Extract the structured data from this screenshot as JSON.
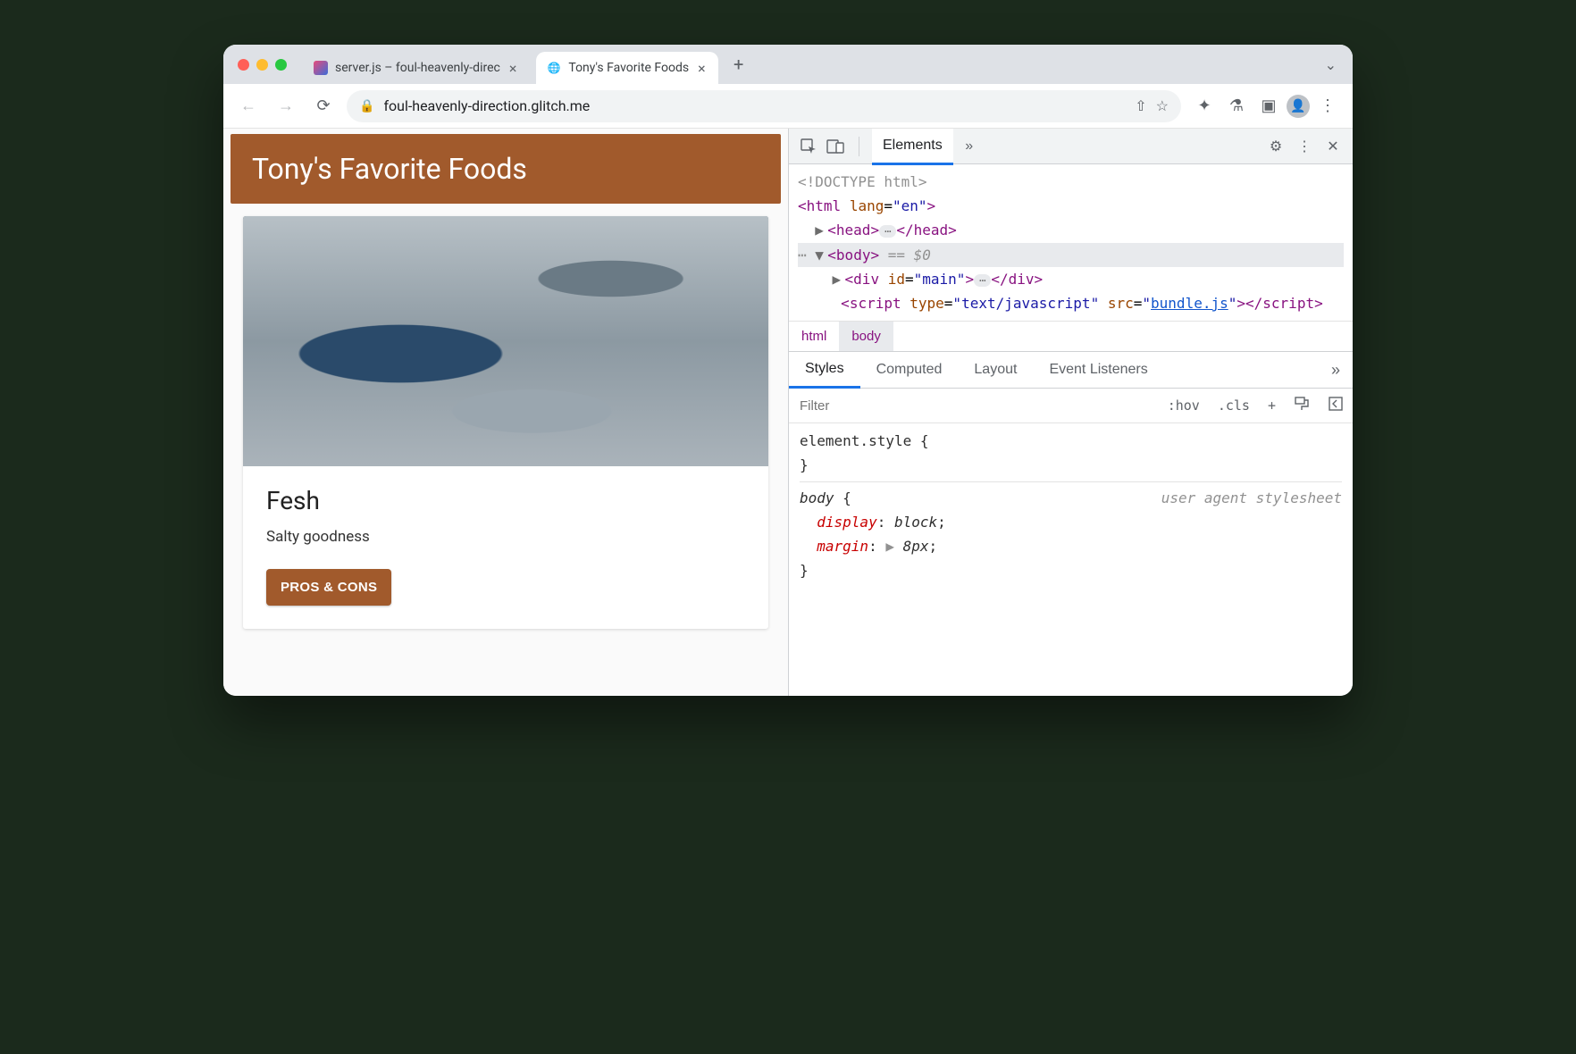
{
  "tabs": [
    {
      "label": "server.js – foul-heavenly-direc",
      "active": false
    },
    {
      "label": "Tony's Favorite Foods",
      "active": true
    }
  ],
  "omnibox": {
    "url": "foul-heavenly-direction.glitch.me"
  },
  "page": {
    "header": "Tony's Favorite Foods",
    "card": {
      "title": "Fesh",
      "subtitle": "Salty goodness",
      "button": "PROS & CONS"
    }
  },
  "devtools": {
    "top_tabs": {
      "active": "Elements"
    },
    "elements": {
      "doctype": "<!DOCTYPE html>",
      "html_open": {
        "tag": "html",
        "attr": "lang",
        "val": "en"
      },
      "head": {
        "tag": "head"
      },
      "body": {
        "tag": "body",
        "ref": "== $0"
      },
      "div_main": {
        "tag": "div",
        "attr": "id",
        "val": "main"
      },
      "script": {
        "tag": "script",
        "type_attr": "type",
        "type_val": "text/javascript",
        "src_attr": "src",
        "src_val": "bundle.js"
      }
    },
    "breadcrumb": [
      "html",
      "body"
    ],
    "styles_tabs": [
      "Styles",
      "Computed",
      "Layout",
      "Event Listeners"
    ],
    "filter_placeholder": "Filter",
    "toolbar_labels": {
      "hov": ":hov",
      "cls": ".cls",
      "plus": "+"
    },
    "rules": {
      "element_style_label": "element.style",
      "body_rule": {
        "selector": "body",
        "source": "user agent stylesheet",
        "decls": [
          {
            "prop": "display",
            "val": "block"
          },
          {
            "prop": "margin",
            "val": "8px",
            "expandable": true
          }
        ]
      }
    }
  }
}
